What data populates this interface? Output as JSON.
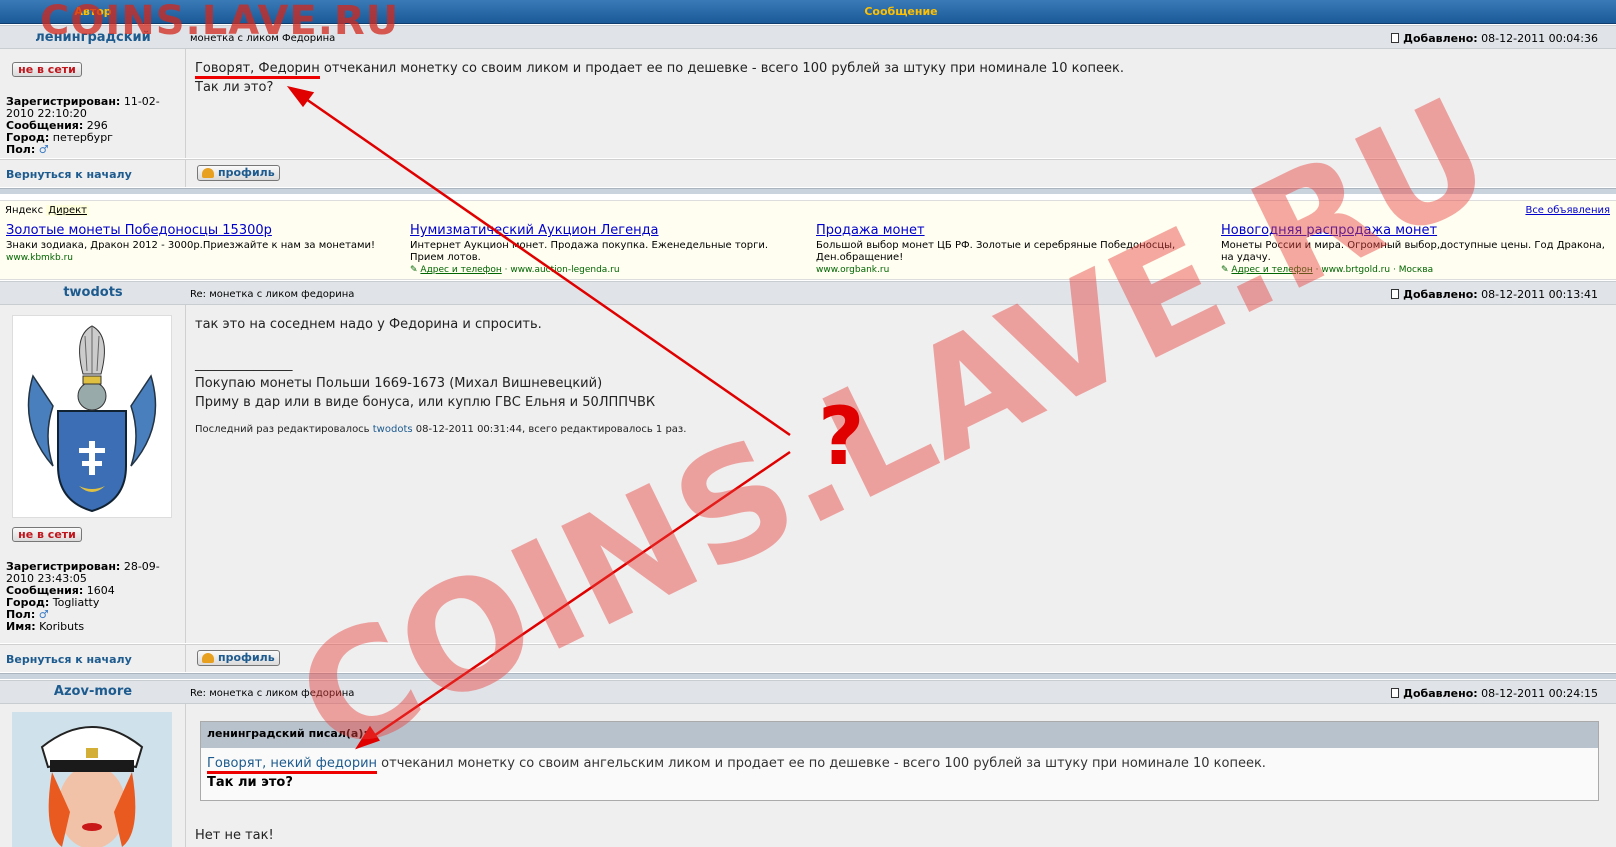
{
  "header": {
    "author_col": "Автор",
    "message_col": "Сообщение"
  },
  "watermark": {
    "text": "COINS.LAVE.RU",
    "question": "?"
  },
  "posts": [
    {
      "author": "ленинградский",
      "subject": "монетка с ликом Федорина",
      "added_label": "Добавлено:",
      "added_date": "08-12-2011 00:04:36",
      "status": "не в сети",
      "registered_label": "Зарегистрирован:",
      "registered": "11-02-2010 22:10:20",
      "messages_label": "Сообщения:",
      "messages": "296",
      "city_label": "Город:",
      "city": "петербург",
      "gender_label": "Пол:",
      "gender_icon": "male-icon",
      "back": "Вернуться к началу",
      "profile": "профиль",
      "body_highlight": "Говорят, Федорин",
      "body_rest": " отчеканил монетку со своим ликом и продает ее по дешевке - всего 100 рублей за штуку при номинале 10 копеек.",
      "body_line2": "Так ли это?"
    },
    {
      "author": "twodots",
      "subject": "Re: монетка с ликом федорина",
      "added_label": "Добавлено:",
      "added_date": "08-12-2011 00:13:41",
      "status": "не в сети",
      "registered_label": "Зарегистрирован:",
      "registered": "28-09-2010 23:43:05",
      "messages_label": "Сообщения:",
      "messages": "1604",
      "city_label": "Город:",
      "city": "Togliatty",
      "gender_label": "Пол:",
      "gender_icon": "male-icon",
      "name_label": "Имя:",
      "name": "Koributs",
      "back": "Вернуться к началу",
      "profile": "профиль",
      "body_line1": "так это на соседнем надо у Федорина и спросить.",
      "sig_rule": "_______________",
      "sig_line1": "Покупаю монеты Польши 1669-1673 (Михал Вишневецкий)",
      "sig_line2": "Приму в дар или в виде бонуса, или куплю ГВС Ельня и 50ЛППЧВК",
      "edited_prefix": "Последний раз редактировалось ",
      "edited_user": "twodots",
      "edited_suffix": " 08-12-2011 00:31:44, всего редактировалось 1 раз."
    },
    {
      "author": "Azov-more",
      "subject": "Re: монетка с ликом федорина",
      "added_label": "Добавлено:",
      "added_date": "08-12-2011 00:24:15",
      "quote_author": "ленинградский писал(а):",
      "quote_highlight": "Говорят, некий федорин",
      "quote_rest": " отчеканил монетку со своим ангельским ликом и продает ее по дешевке - всего 100 рублей за штуку при номинале 10 копеек.",
      "quote_line2": "Так ли это?",
      "body_line1": "Нет не так!"
    }
  ],
  "ads": {
    "yandex": "Яндекс",
    "direct": "Директ",
    "all": "Все объявления",
    "items": [
      {
        "title": "Золотые монеты Победоносцы 15300р",
        "desc": "Знаки зодиака, Дракон 2012 - 3000р.Приезжайте к нам за монетами!",
        "url": "www.kbmkb.ru",
        "contact": "",
        "extra": ""
      },
      {
        "title": "Нумизматический Аукцион Легенда",
        "desc": "Интернет Аукцион монет. Продажа покупка. Еженедельные торги. Прием лотов.",
        "url": "www.auction-legenda.ru",
        "contact": "Адрес и телефон",
        "extra": ""
      },
      {
        "title": "Продажа монет",
        "desc": "Большой выбор монет ЦБ РФ. Золотые и серебряные Победоносцы, Ден.обращение!",
        "url": "www.orgbank.ru",
        "contact": "",
        "extra": ""
      },
      {
        "title": "Новогодняя распродажа монет",
        "desc": "Монеты России и мира. Огромный выбор,доступные цены. Год Дракона, на удачу.",
        "url": "www.brtgold.ru",
        "contact": "Адрес и телефон",
        "extra": "Москва"
      }
    ]
  },
  "colors": {
    "accent": "#ffc000",
    "link": "#1d5b8f",
    "offline": "#c0151c",
    "annotation": "#e00000",
    "watermark": "#e8413c"
  }
}
